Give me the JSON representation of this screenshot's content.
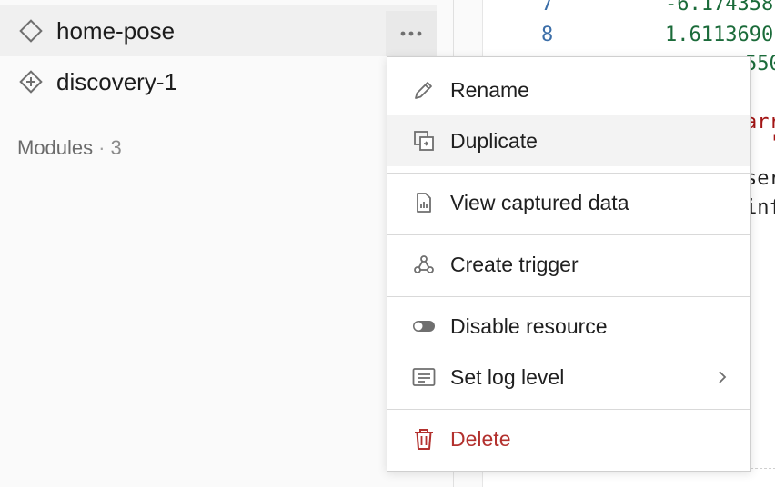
{
  "sidebar": {
    "resources": [
      {
        "label": "home-pose",
        "icon": "diamond-icon"
      },
      {
        "label": "discovery-1",
        "icon": "diamond-target-icon"
      }
    ],
    "more_icon": "ellipsis-icon",
    "modules_label": "Modules",
    "modules_separator": "·",
    "modules_count": "3"
  },
  "code": {
    "lines": [
      {
        "ln": "7",
        "value": "-6.174358"
      },
      {
        "ln": "8",
        "value": "1.6113690"
      }
    ],
    "fragments": [
      "550",
      "arr",
      "'",
      "ser",
      "inf"
    ]
  },
  "menu": {
    "items": [
      {
        "label": "Rename",
        "icon": "pencil-icon"
      },
      {
        "label": "Duplicate",
        "icon": "duplicate-icon"
      },
      {
        "label": "View captured data",
        "icon": "chart-file-icon"
      },
      {
        "label": "Create trigger",
        "icon": "webhook-icon"
      },
      {
        "label": "Disable resource",
        "icon": "toggle-icon"
      },
      {
        "label": "Set log level",
        "icon": "log-list-icon",
        "submenu_icon": "chevron-right-icon"
      },
      {
        "label": "Delete",
        "icon": "trash-icon"
      }
    ]
  },
  "colors": {
    "danger": "#b3312e",
    "icon_gray": "#6f6f6f",
    "hover_bg": "#f3f3f3"
  }
}
